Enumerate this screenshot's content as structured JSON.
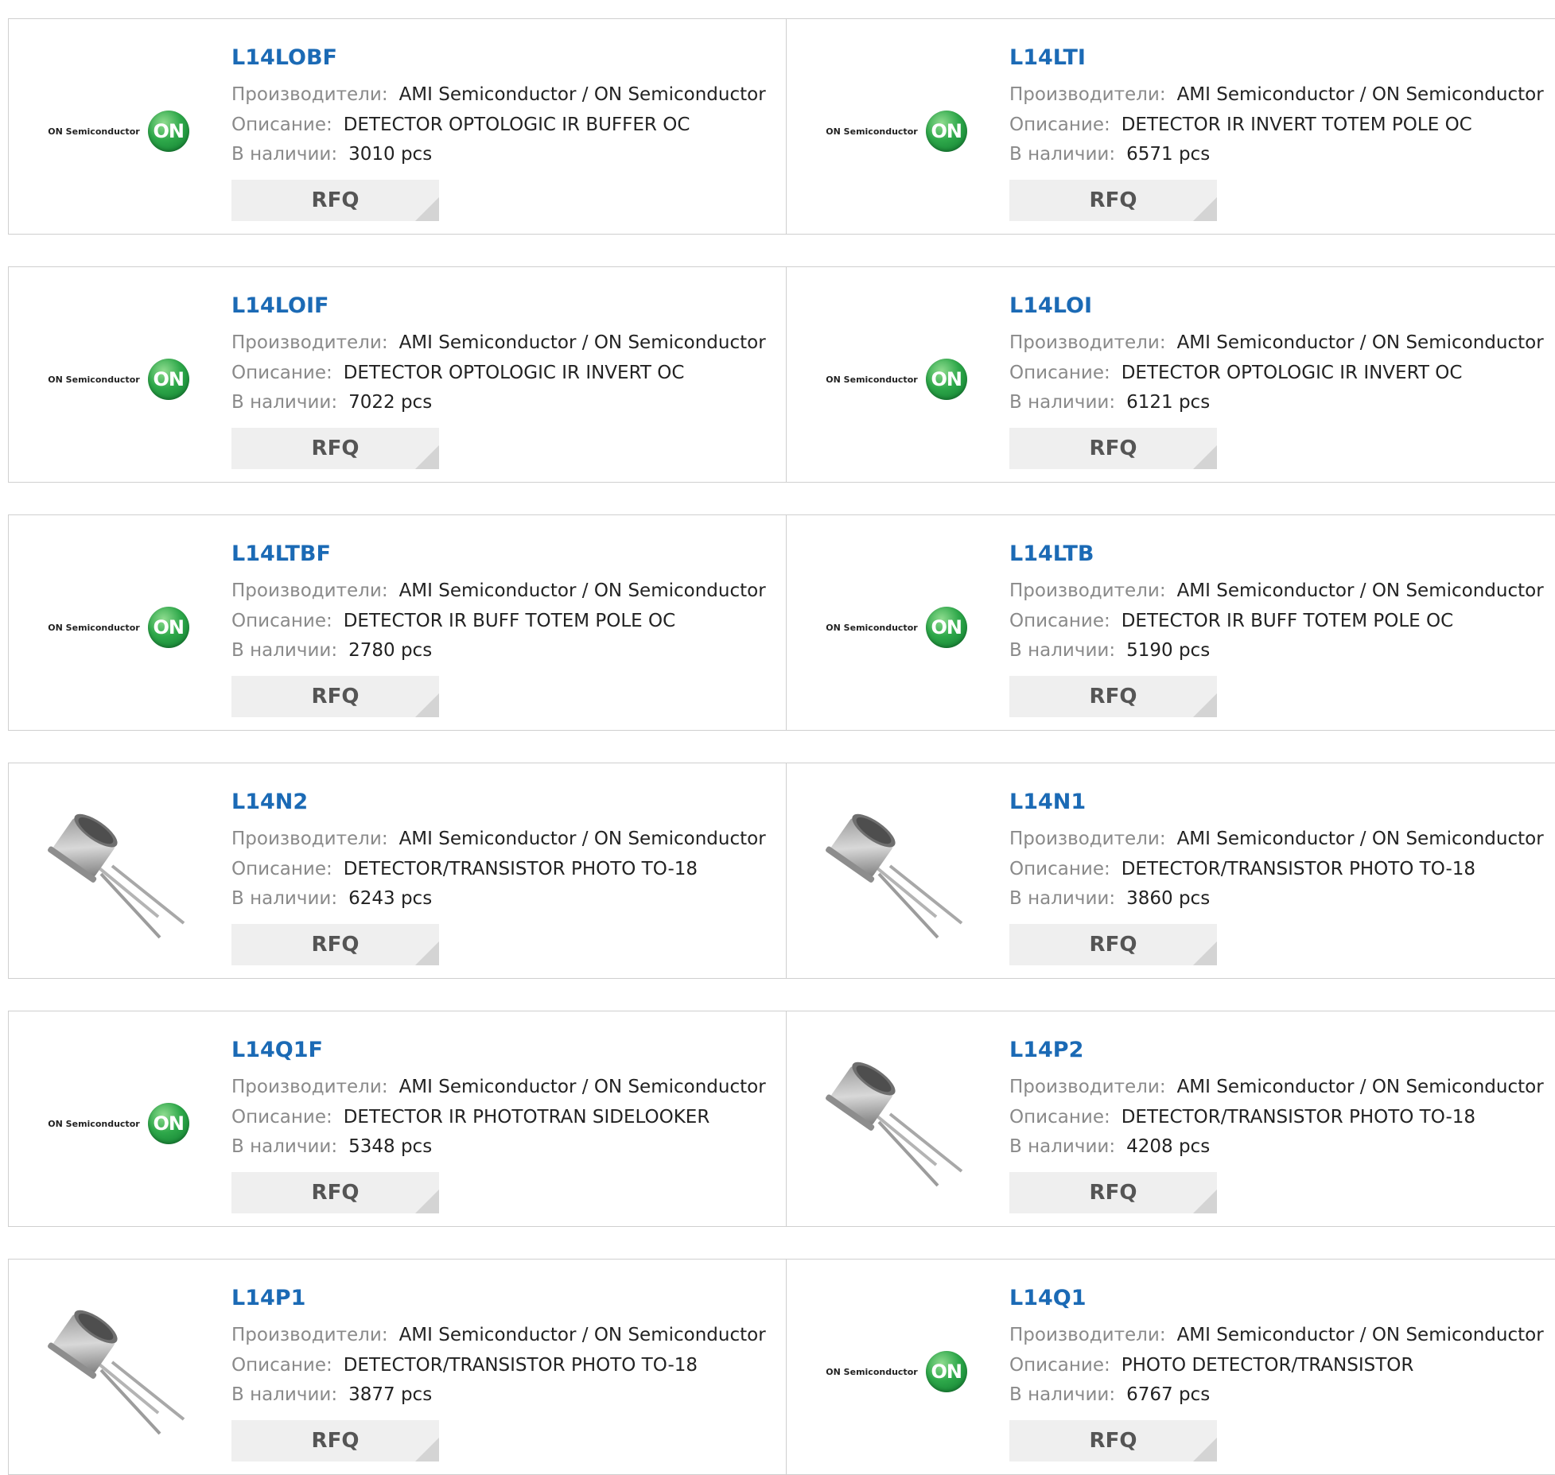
{
  "labels": {
    "manufacturer": "Производители:",
    "description": "Описание:",
    "stock": "В наличии:",
    "rfq": "RFQ"
  },
  "logo": {
    "brand_text": "ON Semiconductor",
    "badge_text": "ON"
  },
  "colors": {
    "part_link": "#1b6ab5",
    "rfq_bg": "#efefef",
    "border": "#cfcfcf",
    "on_green": "#2ea84a"
  },
  "rows": [
    [
      {
        "part": "L14LOBF",
        "image": "on-semiconductor-logo",
        "manufacturer": "AMI Semiconductor / ON Semiconductor",
        "description": "DETECTOR OPTOLOGIC IR BUFFER OC",
        "stock": "3010 pcs"
      },
      {
        "part": "L14LTI",
        "image": "on-semiconductor-logo",
        "manufacturer": "AMI Semiconductor / ON Semiconductor",
        "description": "DETECTOR IR INVERT TOTEM POLE OC",
        "stock": "6571 pcs"
      }
    ],
    [
      {
        "part": "L14LOIF",
        "image": "on-semiconductor-logo",
        "manufacturer": "AMI Semiconductor / ON Semiconductor",
        "description": "DETECTOR OPTOLOGIC IR INVERT OC",
        "stock": "7022 pcs"
      },
      {
        "part": "L14LOI",
        "image": "on-semiconductor-logo",
        "manufacturer": "AMI Semiconductor / ON Semiconductor",
        "description": "DETECTOR OPTOLOGIC IR INVERT OC",
        "stock": "6121 pcs"
      }
    ],
    [
      {
        "part": "L14LTBF",
        "image": "on-semiconductor-logo",
        "manufacturer": "AMI Semiconductor / ON Semiconductor",
        "description": "DETECTOR IR BUFF TOTEM POLE OC",
        "stock": "2780 pcs"
      },
      {
        "part": "L14LTB",
        "image": "on-semiconductor-logo",
        "manufacturer": "AMI Semiconductor / ON Semiconductor",
        "description": "DETECTOR IR BUFF TOTEM POLE OC",
        "stock": "5190 pcs"
      }
    ],
    [
      {
        "part": "L14N2",
        "image": "to-18-transistor-photo",
        "manufacturer": "AMI Semiconductor / ON Semiconductor",
        "description": "DETECTOR/TRANSISTOR PHOTO TO-18",
        "stock": "6243 pcs"
      },
      {
        "part": "L14N1",
        "image": "to-18-transistor-photo",
        "manufacturer": "AMI Semiconductor / ON Semiconductor",
        "description": "DETECTOR/TRANSISTOR PHOTO TO-18",
        "stock": "3860 pcs"
      }
    ],
    [
      {
        "part": "L14Q1F",
        "image": "on-semiconductor-logo",
        "manufacturer": "AMI Semiconductor / ON Semiconductor",
        "description": "DETECTOR IR PHOTOTRAN SIDELOOKER",
        "stock": "5348 pcs"
      },
      {
        "part": "L14P2",
        "image": "to-18-transistor-photo",
        "manufacturer": "AMI Semiconductor / ON Semiconductor",
        "description": "DETECTOR/TRANSISTOR PHOTO TO-18",
        "stock": "4208 pcs"
      }
    ],
    [
      {
        "part": "L14P1",
        "image": "to-18-transistor-photo",
        "manufacturer": "AMI Semiconductor / ON Semiconductor",
        "description": "DETECTOR/TRANSISTOR PHOTO TO-18",
        "stock": "3877 pcs"
      },
      {
        "part": "L14Q1",
        "image": "on-semiconductor-logo",
        "manufacturer": "AMI Semiconductor / ON Semiconductor",
        "description": "PHOTO DETECTOR/TRANSISTOR",
        "stock": "6767 pcs"
      }
    ]
  ]
}
